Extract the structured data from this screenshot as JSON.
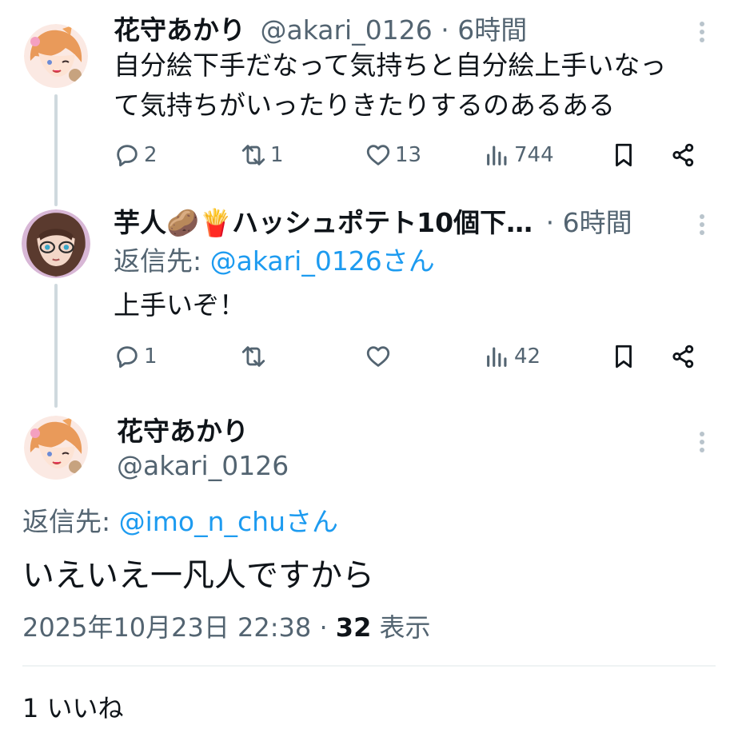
{
  "thread": [
    {
      "display_name": "花守あかり",
      "handle": "@akari_0126",
      "separator": "·",
      "time": "6時間",
      "text_lines": [
        "自分絵下手だなって気持ちと自分絵上手いなっ",
        "て気持ちがいったりきたりするのあるある"
      ],
      "replies": "2",
      "reposts": "1",
      "likes": "13",
      "views": "744"
    },
    {
      "display_name": "芋人🥔🍟ハッシュポテト10個下…",
      "separator": "·",
      "time": "6時間",
      "reply_to_prefix": "返信先: ",
      "reply_to_handle": "@akari_0126さん",
      "text": "上手いぞ！",
      "replies": "1",
      "reposts": "",
      "likes": "",
      "views": "42"
    }
  ],
  "main": {
    "display_name": "花守あかり",
    "handle": "@akari_0126",
    "reply_to_prefix": "返信先: ",
    "reply_to_handle": "@imo_n_chuさん",
    "text": "いえいえ一凡人ですから",
    "timestamp": "2025年10月23日 22:38",
    "separator": "·",
    "views_count": "32",
    "views_label": "表示",
    "likes_summary": "1 いいね"
  },
  "icons": {
    "reply": "reply-icon",
    "repost": "repost-icon",
    "like": "heart-icon",
    "views": "views-icon",
    "bookmark": "bookmark-icon",
    "share": "share-icon",
    "more": "more-icon"
  }
}
